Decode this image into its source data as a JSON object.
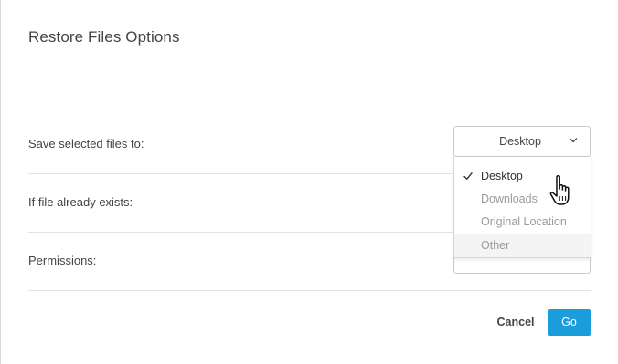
{
  "dialog": {
    "title": "Restore Files Options"
  },
  "rows": [
    {
      "label": "Save selected files to:",
      "value": "Desktop"
    },
    {
      "label": "If file already exists:"
    },
    {
      "label": "Permissions:"
    }
  ],
  "dropdown": {
    "options": [
      {
        "label": "Desktop",
        "selected": true
      },
      {
        "label": "Downloads"
      },
      {
        "label": "Original Location"
      },
      {
        "label": "Other",
        "hovered": true
      }
    ]
  },
  "buttons": {
    "cancel": "Cancel",
    "go": "Go"
  },
  "colors": {
    "accent": "#1a9ddb",
    "border": "#c9c9c9",
    "muted_text": "#9a9a9a"
  },
  "icons": {
    "select_chevron": "chevron-down-icon",
    "selected_check": "check-icon",
    "pointer": "hand-pointer-cursor-icon"
  }
}
